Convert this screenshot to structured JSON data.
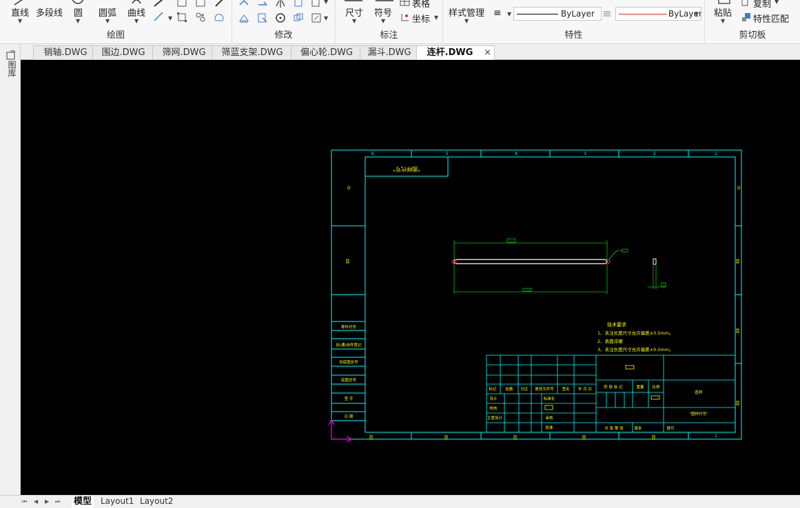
{
  "ribbon": {
    "draw": {
      "label": "绘图",
      "line": "直线",
      "polyline": "多段线",
      "circle": "圆",
      "arc": "圆弧",
      "curve": "曲线"
    },
    "modify": {
      "label": "修改"
    },
    "annotate": {
      "label": "标注",
      "dimension": "尺寸",
      "symbol": "符号",
      "table": "表格",
      "coordinate": "坐标"
    },
    "properties": {
      "label": "特性",
      "style_manager": "样式管理",
      "linetype": "ByLayer",
      "lineweight": "ByLayer"
    },
    "clipboard": {
      "label": "剪切板",
      "paste": "粘贴",
      "copy": "复制",
      "match": "特性匹配"
    }
  },
  "left_panel": {
    "label": "图库"
  },
  "document_tabs": [
    {
      "label": "销轴.DWG",
      "active": false
    },
    {
      "label": "围边.DWG",
      "active": false
    },
    {
      "label": "筛网.DWG",
      "active": false
    },
    {
      "label": "筛蓝支架.DWG",
      "active": false
    },
    {
      "label": "偏心轮.DWG",
      "active": false
    },
    {
      "label": "漏斗.DWG",
      "active": false
    },
    {
      "label": "连杆.DWG",
      "active": true
    }
  ],
  "close_glyph": "×",
  "layout_tabs": [
    {
      "label": "模型",
      "active": true
    },
    {
      "label": "Layout1",
      "active": false
    },
    {
      "label": "Layout2",
      "active": false
    }
  ],
  "nav_arrows": [
    "⏮",
    "◀",
    "▶",
    "⏭"
  ],
  "drawing": {
    "colors": {
      "frame": "#00ffff",
      "text": "#ffff00",
      "dim": "#00cc00",
      "part": "#ffffff",
      "ucs": "#ff00ff",
      "marker": "#ff3030"
    },
    "zone_numbers_top": [
      "6",
      "5",
      "4",
      "3",
      "2",
      "1"
    ],
    "zone_letter_left": "D",
    "zone_letter_right": "D",
    "zone_number_bottom_right": "1",
    "drawing_number_box": "\"图样代号\"",
    "side_labels": [
      "零件代号",
      "旧(通)用件登记",
      "旧底图总号",
      "底图总号",
      "签  字",
      "日  期"
    ],
    "tech_req": {
      "title": "技术要求",
      "items": [
        "1、未注长度尺寸允许偏差±0.5mm。",
        "2、表面淬硬",
        "3、未注长度尺寸允许偏差±0.5mm。"
      ]
    },
    "title_block": {
      "rev_headers": [
        "标记",
        "处数",
        "分区",
        "更改文件号",
        "签名",
        "年 月 日"
      ],
      "row_design": [
        "设计",
        "标准化"
      ],
      "row_check": [
        "校核"
      ],
      "row_process": [
        "主管设计",
        "审核"
      ],
      "row_approve": [
        "批准"
      ],
      "stage_headers": [
        "阶 段 标 记",
        "重量",
        "比例"
      ],
      "part_name": "连杆",
      "drawing_code": "\"图样代号\"",
      "sheets": "共  张  第  张",
      "version": "版本",
      "replace": "替代"
    }
  }
}
